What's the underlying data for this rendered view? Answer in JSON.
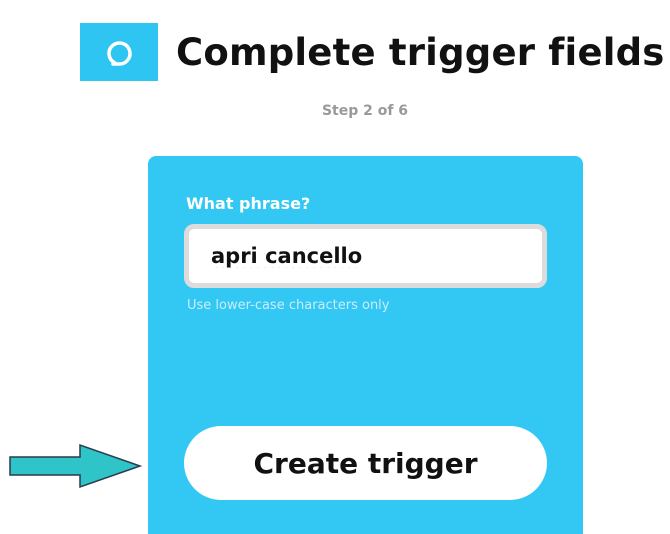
{
  "header": {
    "title": "Complete trigger fields",
    "service_icon": "alexa-ring-icon",
    "brand_color": "#2ec5f3"
  },
  "step": {
    "text": "Step 2 of 6"
  },
  "form": {
    "field_label": "What phrase?",
    "field_value": "apri cancello",
    "helper_text": "Use lower-case characters only",
    "submit_label": "Create trigger",
    "panel_color": "#33c7f3"
  },
  "annotation": {
    "arrow_icon": "right-arrow-icon",
    "arrow_color": "#2ec4c8"
  }
}
